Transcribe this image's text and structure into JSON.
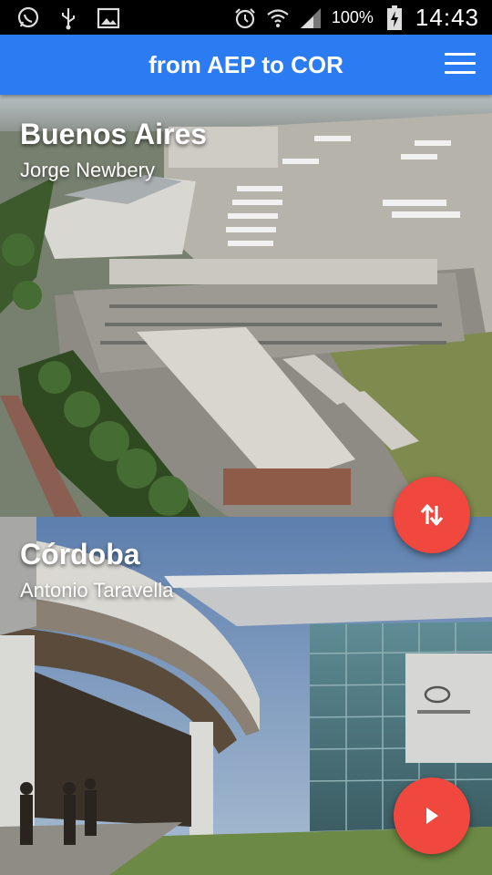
{
  "status_bar": {
    "battery_percent": "100%",
    "time": "14:43",
    "icons_left": [
      "whatsapp-icon",
      "usb-icon",
      "image-icon"
    ],
    "icons_right": [
      "alarm-icon",
      "wifi-icon",
      "signal-icon",
      "battery-charging-icon"
    ]
  },
  "app_bar": {
    "title": "from AEP to COR",
    "menu_icon": "menu-icon"
  },
  "origin": {
    "city": "Buenos Aires",
    "airport": "Jorge Newbery"
  },
  "destination": {
    "city": "Córdoba",
    "airport": "Antonio Taravella"
  },
  "actions": {
    "swap_icon": "swap-vertical-icon",
    "go_icon": "play-arrow-icon",
    "fab_color": "#f0473f"
  },
  "colors": {
    "app_bar": "#2b7cf3"
  }
}
